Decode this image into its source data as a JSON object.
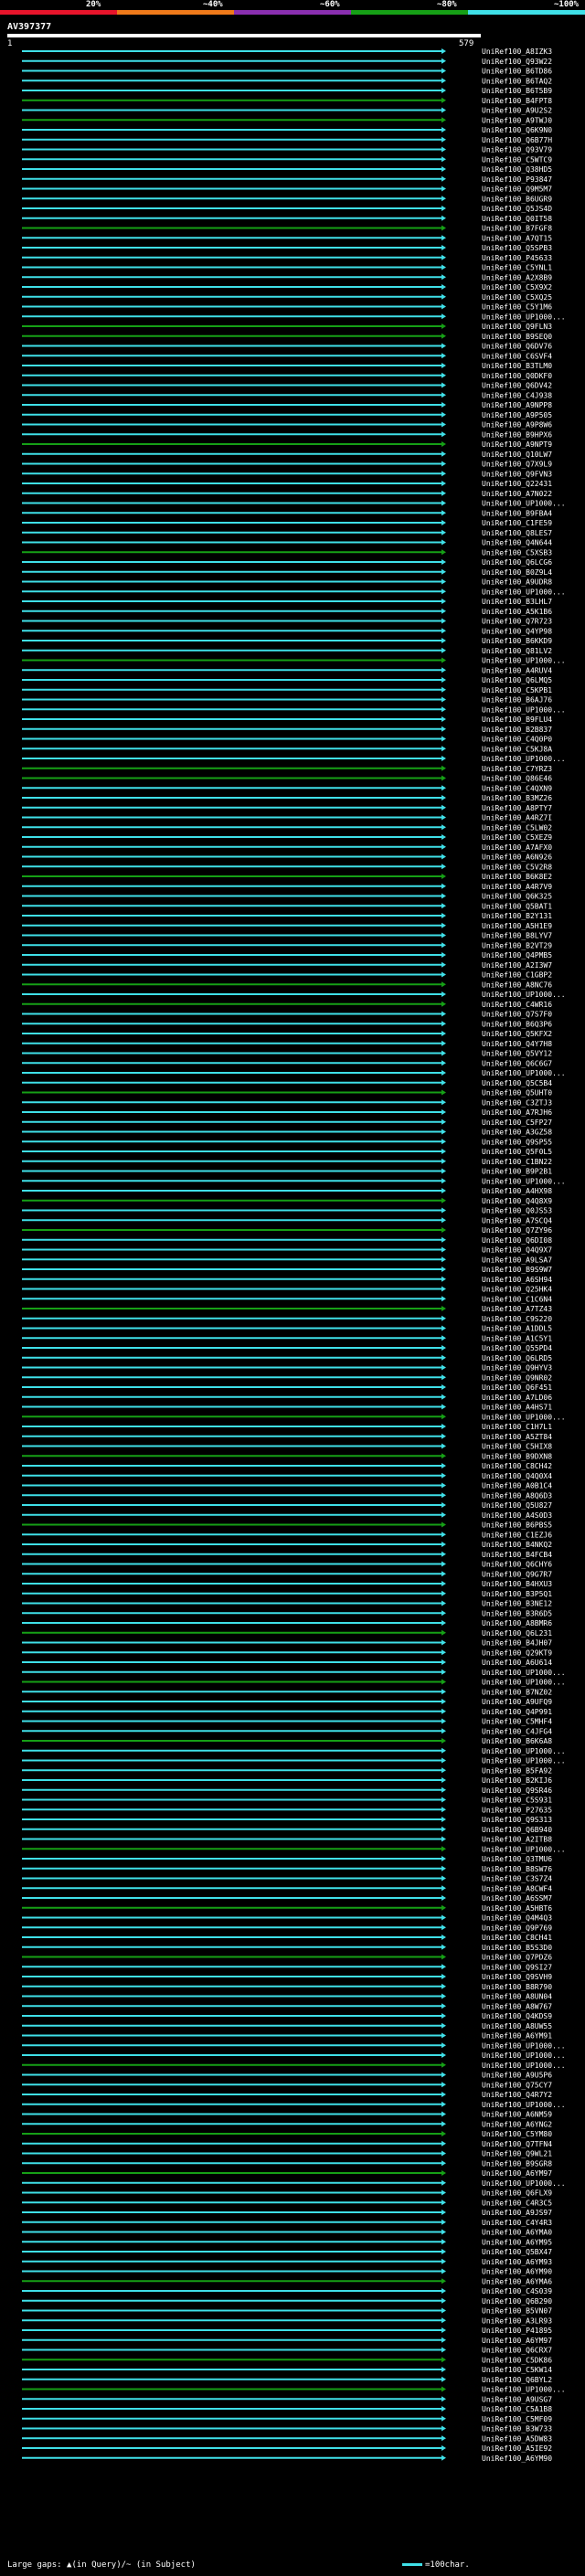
{
  "legend": {
    "items": [
      {
        "label": "20%",
        "color": "#e8142b"
      },
      {
        "label": "~40%",
        "color": "#ef7a1a"
      },
      {
        "label": "~60%",
        "color": "#8a2fb0"
      },
      {
        "label": "~80%",
        "color": "#16a016"
      },
      {
        "label": "~100%",
        "color": "#3fe0e8"
      }
    ]
  },
  "query": {
    "title": "AV397377",
    "start_tick": "1",
    "end_tick": "579"
  },
  "colors": {
    "hit": "#3fe0e8",
    "hit_alt": "#16a016",
    "query": "#ffffff"
  },
  "hits": [
    "UniRef100_A8IZK3",
    "UniRef100_Q93W22",
    "UniRef100_B6TD86",
    "UniRef100_B6TAQ2",
    "UniRef100_B6T5B9",
    "UniRef100_B4FPT8",
    "UniRef100_A9U2S2",
    "UniRef100_A9TWJ0",
    "UniRef100_Q6K9N0",
    "UniRef100_Q6B77H",
    "UniRef100_Q93V79",
    "UniRef100_C5WTC9",
    "UniRef100_Q38HD5",
    "UniRef100_P93847",
    "UniRef100_Q9M5M7",
    "UniRef100_B6UGR9",
    "UniRef100_Q5JS4D",
    "UniRef100_Q0IT58",
    "UniRef100_B7FGF8",
    "UniRef100_A7QT15",
    "UniRef100_Q5SPB3",
    "UniRef100_P45633",
    "UniRef100_C5YNL1",
    "UniRef100_A2X8B9",
    "UniRef100_C5X9X2",
    "UniRef100_C5XQ25",
    "UniRef100_C5Y1M6",
    "UniRef100_UP1000...",
    "UniRef100_Q9FLN3",
    "UniRef100_B9SEQ0",
    "UniRef100_Q6DV76",
    "UniRef100_C6SVF4",
    "UniRef100_B3TLM0",
    "UniRef100_Q0DKF0",
    "UniRef100_Q6DV42",
    "UniRef100_C4J938",
    "UniRef100_A9NPP8",
    "UniRef100_A9P505",
    "UniRef100_A9P8W6",
    "UniRef100_B9HPX6",
    "UniRef100_A9NPT9",
    "UniRef100_Q10LW7",
    "UniRef100_Q7X9L9",
    "UniRef100_Q9FVN3",
    "UniRef100_Q22431",
    "UniRef100_A7N022",
    "UniRef100_UP1000...",
    "UniRef100_B9FBA4",
    "UniRef100_C1FE59",
    "UniRef100_Q8LES7",
    "UniRef100_Q4N644",
    "UniRef100_C5XSB3",
    "UniRef100_Q6LCG6",
    "UniRef100_B0Z9L4",
    "UniRef100_A9UDR8",
    "UniRef100_UP1000...",
    "UniRef100_B3LHL7",
    "UniRef100_A5K1B6",
    "UniRef100_Q7R723",
    "UniRef100_Q4YP98",
    "UniRef100_B6KKD9",
    "UniRef100_Q81LV2",
    "UniRef100_UP1000...",
    "UniRef100_A4RUV4",
    "UniRef100_Q6LMQ5",
    "UniRef100_C5KPB1",
    "UniRef100_B6AJ76",
    "UniRef100_UP1000...",
    "UniRef100_B9FLU4",
    "UniRef100_B2B837",
    "UniRef100_C4Q0P0",
    "UniRef100_C5KJ8A",
    "UniRef100_UP1000...",
    "UniRef100_C7YRZ3",
    "UniRef100_Q86E46",
    "UniRef100_C4QXN9",
    "UniRef100_B3MZ26",
    "UniRef100_A8PTY7",
    "UniRef100_A4RZ7I",
    "UniRef100_C5LW02",
    "UniRef100_C5XEZ9",
    "UniRef100_A7AFX0",
    "UniRef100_A6N926",
    "UniRef100_C5V2R8",
    "UniRef100_B6K8E2",
    "UniRef100_A4R7V9",
    "UniRef100_Q6K325",
    "UniRef100_Q5BAT1",
    "UniRef100_B2Y131",
    "UniRef100_A5H1E9",
    "UniRef100_B8LYV7",
    "UniRef100_B2VT29",
    "UniRef100_Q4PMB5",
    "UniRef100_A2I3W7",
    "UniRef100_C1GBP2",
    "UniRef100_A8NC76",
    "UniRef100_UP1000...",
    "UniRef100_C4WR16",
    "UniRef100_Q7S7F0",
    "UniRef100_B6Q3P6",
    "UniRef100_Q5KFX2",
    "UniRef100_Q4Y7H8",
    "UniRef100_Q5VY12",
    "UniRef100_Q6C6G7",
    "UniRef100_UP1000...",
    "UniRef100_Q5C5B4",
    "UniRef100_Q5UHT0",
    "UniRef100_C3ZTJ3",
    "UniRef100_A7RJH6",
    "UniRef100_C5FP27",
    "UniRef100_A3GZ58",
    "UniRef100_Q9SP55",
    "UniRef100_Q5F0L5",
    "UniRef100_C1BN22",
    "UniRef100_B9P2B1",
    "UniRef100_UP1000...",
    "UniRef100_A4HX98",
    "UniRef100_Q4Q8X9",
    "UniRef100_Q0JS53",
    "UniRef100_A7SCQ4",
    "UniRef100_Q7ZY96",
    "UniRef100_Q6DI08",
    "UniRef100_Q4Q9X7",
    "UniRef100_A9LSA7",
    "UniRef100_B9S9W7",
    "UniRef100_A6SH94",
    "UniRef100_Q25HK4",
    "UniRef100_C1C6N4",
    "UniRef100_A7TZ43",
    "UniRef100_C9S220",
    "UniRef100_A1DDL5",
    "UniRef100_A1C5Y1",
    "UniRef100_Q55PD4",
    "UniRef100_Q6LRD5",
    "UniRef100_Q9HYV3",
    "UniRef100_Q9NR02",
    "UniRef100_Q6F451",
    "UniRef100_A7LD06",
    "UniRef100_A4HS71",
    "UniRef100_UP1000...",
    "UniRef100_C1H7L1",
    "UniRef100_A5ZT84",
    "UniRef100_C5HIX8",
    "UniRef100_B9DXN8",
    "UniRef100_C8CH42",
    "UniRef100_Q4Q0X4",
    "UniRef100_A0B1C4",
    "UniRef100_A8Q6D3",
    "UniRef100_Q5U827",
    "UniRef100_A4S0D3",
    "UniRef100_B6PBS5",
    "UniRef100_C1EZJ6",
    "UniRef100_B4NKQ2",
    "UniRef100_B4FCB4",
    "UniRef100_Q6CHY6",
    "UniRef100_Q9G7R7",
    "UniRef100_B4HXU3",
    "UniRef100_B3P5Q1",
    "UniRef100_B3NE12",
    "UniRef100_B3R6D5",
    "UniRef100_A8BMR6",
    "UniRef100_Q6L231",
    "UniRef100_B4JH07",
    "UniRef100_Q29KT9",
    "UniRef100_A6U614",
    "UniRef100_UP1000...",
    "UniRef100_UP1000...",
    "UniRef100_B7NZ02",
    "UniRef100_A9UFQ9",
    "UniRef100_Q4P991",
    "UniRef100_C5MHF4",
    "UniRef100_C4JFG4",
    "UniRef100_B6K6A8",
    "UniRef100_UP1000...",
    "UniRef100_UP1000...",
    "UniRef100_B5FA92",
    "UniRef100_B2KIJ6",
    "UniRef100_Q9SR46",
    "UniRef100_C5S931",
    "UniRef100_P27635",
    "UniRef100_Q9S313",
    "UniRef100_Q6B940",
    "UniRef100_A2ITB8",
    "UniRef100_UP1000...",
    "UniRef100_Q3TMU6",
    "UniRef100_B8SW76",
    "UniRef100_C3S7Z4",
    "UniRef100_A8CWF4",
    "UniRef100_A6SSM7",
    "UniRef100_A5HBT6",
    "UniRef100_Q4M4Q3",
    "UniRef100_Q9P769",
    "UniRef100_C8CH41",
    "UniRef100_B5S3D0",
    "UniRef100_Q7PDZ6",
    "UniRef100_Q9SI27",
    "UniRef100_Q9SVH9",
    "UniRef100_B8R790",
    "UniRef100_A8UN04",
    "UniRef100_A8W767",
    "UniRef100_Q4KDS9",
    "UniRef100_A8UW55",
    "UniRef100_A6YM91",
    "UniRef100_UP1000...",
    "UniRef100_UP1000...",
    "UniRef100_UP1000...",
    "UniRef100_A9U5P6",
    "UniRef100_Q75CY7",
    "UniRef100_Q4R7Y2",
    "UniRef100_UP1000...",
    "UniRef100_A6NM59",
    "UniRef100_A6YNG2",
    "UniRef100_C5YM80",
    "UniRef100_Q7TFN4",
    "UniRef100_Q9WL21",
    "UniRef100_B9SGR8",
    "UniRef100_A6YM97",
    "UniRef100_UP1000...",
    "UniRef100_Q6FLX9",
    "UniRef100_C4R3C5",
    "UniRef100_A9JS97",
    "UniRef100_C4Y4R3",
    "UniRef100_A6YMA0",
    "UniRef100_A6YM95",
    "UniRef100_Q5BX47",
    "UniRef100_A6YM93",
    "UniRef100_A6YM90",
    "UniRef100_A6YMA6",
    "UniRef100_C4S039",
    "UniRef100_Q6B290",
    "UniRef100_B5VN07",
    "UniRef100_A3LR93",
    "UniRef100_P41895",
    "UniRef100_A6YM97",
    "UniRef100_Q6CRX7",
    "UniRef100_C5DK86",
    "UniRef100_C5KW14",
    "UniRef100_Q6BYL2",
    "UniRef100_UP1000...",
    "UniRef100_A9USG7",
    "UniRef100_C5A1B8",
    "UniRef100_C5MF09",
    "UniRef100_B3W733",
    "UniRef100_A5DW83",
    "UniRef100_A5IE92",
    "UniRef100_A6YM90"
  ],
  "footer": {
    "left_text": "Large gaps: ▲(in Query)/~ (in Subject)",
    "right_text": "=100char."
  }
}
